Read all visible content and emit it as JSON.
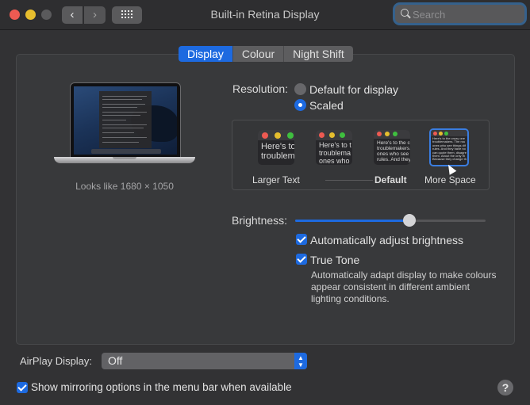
{
  "window": {
    "title": "Built-in Retina Display",
    "traffic_lights": [
      "close",
      "minimize",
      "zoom-disabled"
    ],
    "nav": {
      "back_icon": "chevron-left-icon",
      "forward_icon": "chevron-right-icon",
      "back_glyph": "‹",
      "forward_glyph": "›",
      "grid_icon": "grid-icon"
    },
    "search": {
      "placeholder": "Search",
      "value": ""
    }
  },
  "tabs": [
    {
      "label": "Display",
      "active": true
    },
    {
      "label": "Colour",
      "active": false
    },
    {
      "label": "Night Shift",
      "active": false
    }
  ],
  "preview": {
    "looks_like": "Looks like 1680 × 1050"
  },
  "resolution": {
    "label": "Resolution:",
    "options": [
      {
        "label": "Default for display",
        "selected": false
      },
      {
        "label": "Scaled",
        "selected": true
      }
    ],
    "scales": [
      {
        "label": "Larger Text",
        "sample": "Here's to\ntroublem",
        "selected": false,
        "bold": false
      },
      {
        "label": "",
        "sample": "Here's to t\ntroublema\nones who",
        "selected": false,
        "bold": false
      },
      {
        "label": "Default",
        "sample": "Here's to the c\ntroublemakers.\nones who see t\nrules. And they",
        "selected": false,
        "bold": true
      },
      {
        "label": "More Space",
        "sample": "Here's to the crazy one\ntroublemakers. The rou\nones who see things dif\nrules. And they have no\ncan quote them, disagre\nthem. About the only th\nBecause they change th",
        "selected": true,
        "bold": false
      }
    ]
  },
  "brightness": {
    "label": "Brightness:",
    "value": 0.6,
    "auto_adjust": {
      "label": "Automatically adjust brightness",
      "checked": true
    }
  },
  "true_tone": {
    "label": "True Tone",
    "checked": true,
    "description": "Automatically adapt display to make colours appear consistent in different ambient lighting conditions."
  },
  "airplay": {
    "label": "AirPlay Display:",
    "value": "Off"
  },
  "mirroring": {
    "label": "Show mirroring options in the menu bar when available",
    "checked": true
  },
  "help": {
    "glyph": "?"
  },
  "colors": {
    "accent": "#1d6ae0",
    "red": "#ee5a52",
    "yellow": "#e6be2e",
    "green": "#3fbf3f"
  }
}
